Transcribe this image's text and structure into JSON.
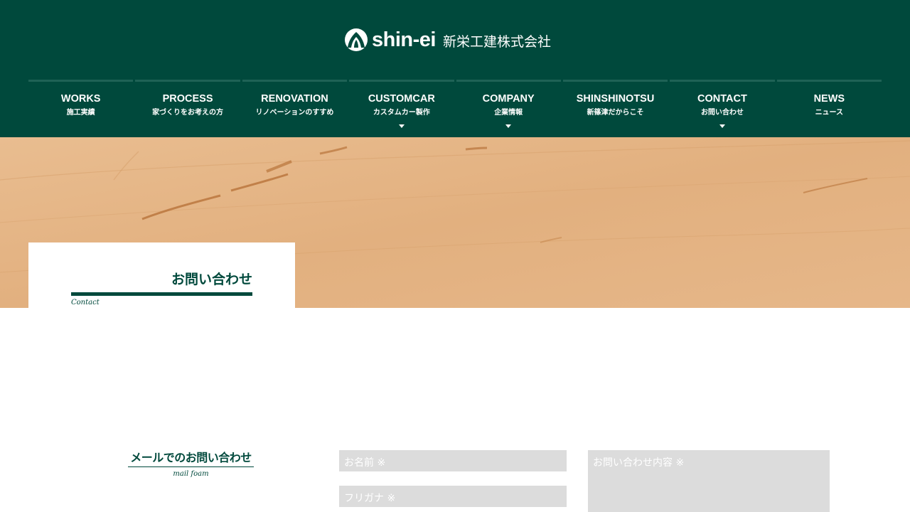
{
  "header": {
    "logo_text": "shin-ei",
    "company_name": "新栄工建株式会社",
    "brand_color": "#00493c"
  },
  "nav": {
    "items": [
      {
        "en": "WORKS",
        "jp": "施工実績",
        "dropdown": false
      },
      {
        "en": "PROCESS",
        "jp": "家づくりをお考えの方",
        "dropdown": false
      },
      {
        "en": "RENOVATION",
        "jp": "リノベーションのすすめ",
        "dropdown": false
      },
      {
        "en": "CUSTOMCAR",
        "jp": "カスタムカー製作",
        "dropdown": true
      },
      {
        "en": "COMPANY",
        "jp": "企業情報",
        "dropdown": true
      },
      {
        "en": "SHINSHINOTSU",
        "jp": "新篠津だからこそ",
        "dropdown": false
      },
      {
        "en": "CONTACT",
        "jp": "お問い合わせ",
        "dropdown": true
      },
      {
        "en": "NEWS",
        "jp": "ニュース",
        "dropdown": false
      }
    ]
  },
  "page": {
    "title": "お問い合わせ",
    "subtitle": "Contact"
  },
  "mail_section": {
    "title": "メールでのお問い合わせ",
    "subtitle": "mail foam"
  },
  "form": {
    "name_placeholder": "お名前 ※",
    "kana_placeholder": "フリガナ ※",
    "message_placeholder": "お問い合わせ内容 ※"
  }
}
